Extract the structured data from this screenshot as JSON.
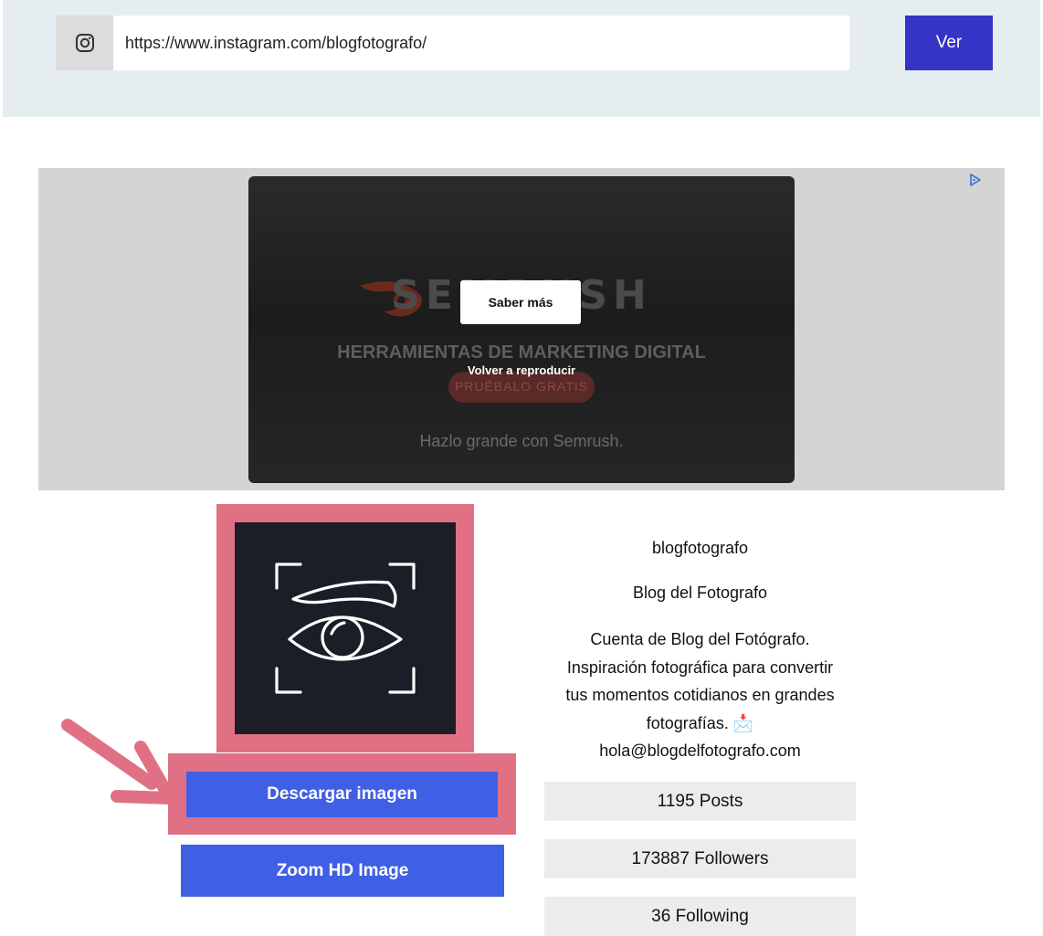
{
  "search": {
    "icon": "instagram-icon",
    "url_value": "https://www.instagram.com/blogfotografo/",
    "submit_label": "Ver",
    "accent_color": "#3434c6"
  },
  "ad": {
    "choices_icon": "adchoices-icon",
    "brand_text": "SEMRUSH",
    "headline": "HERRAMIENTAS DE MARKETING DIGITAL",
    "cta_text": "PRUÉBALO GRATIS",
    "slogan": "Hazlo grande con Semrush.",
    "learn_more_label": "Saber más",
    "replay_label": "Volver a reproducir"
  },
  "profile": {
    "picture_icon": "eye-scan-icon",
    "download_label": "Descargar imagen",
    "zoom_label": "Zoom HD Image",
    "username": "blogfotografo",
    "full_name": "Blog del Fotografo",
    "bio_lines": [
      "Cuenta de Blog del Fotógrafo.",
      "Inspiración fotográfica para convertir",
      "tus momentos cotidianos en grandes",
      "fotografías. 📩",
      "hola@blogdelfotografo.com"
    ],
    "posts": "1195 Posts",
    "followers": "173887 Followers",
    "following": "36 Following",
    "button_color": "#3f5fe4",
    "highlight_color": "#e07185"
  }
}
